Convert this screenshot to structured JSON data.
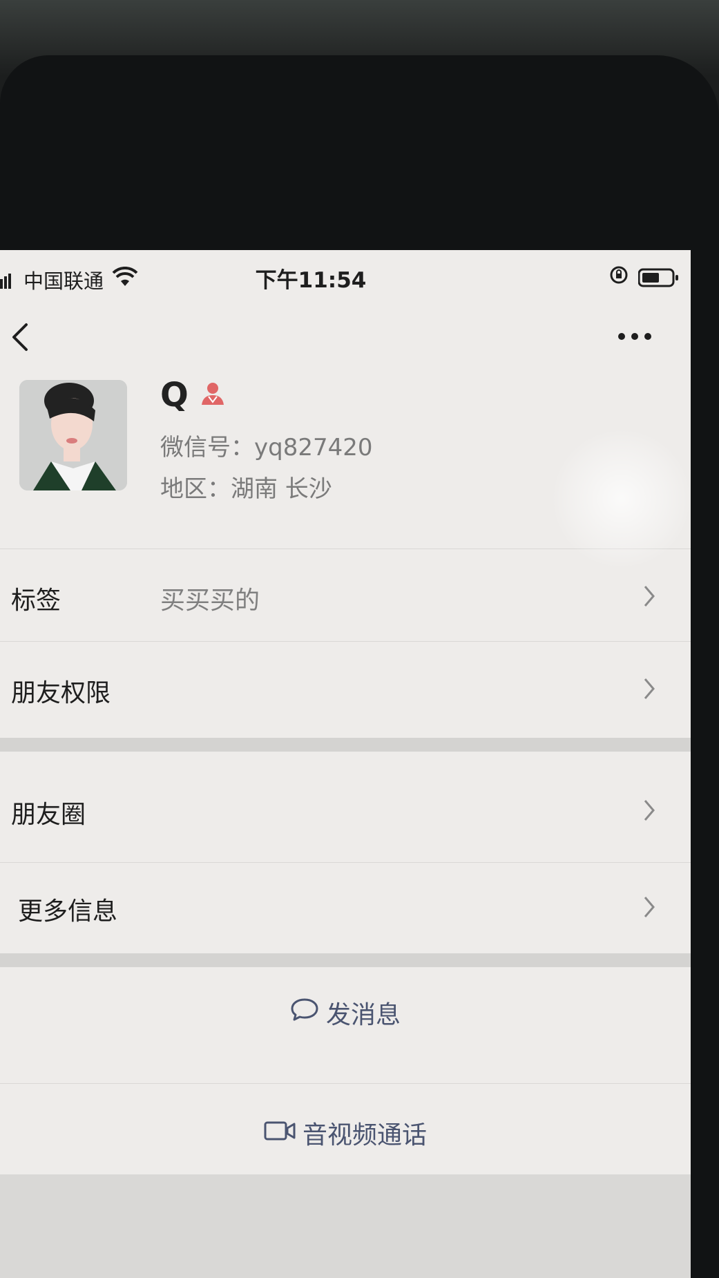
{
  "status_bar": {
    "carrier": "中国联通",
    "time": "下午11:54"
  },
  "profile": {
    "name": "Q",
    "wechat_id": "微信号：yq827420",
    "region": "地区：湖南 长沙"
  },
  "rows": {
    "tags": {
      "label": "标签",
      "value": "买买买的"
    },
    "friend_permissions": {
      "label": "朋友权限"
    },
    "moments": {
      "label": "朋友圈"
    },
    "more_info": {
      "label": "更多信息"
    }
  },
  "actions": {
    "send_message": "发消息",
    "av_call": "音视频通话"
  },
  "colors": {
    "screen_bg": "#eeecea",
    "action_text": "#4a5470",
    "gender_icon": "#e06666",
    "secondary_text": "#7a7a7a"
  },
  "icons": {
    "signal": "signal-bars-icon",
    "wifi": "wifi-icon",
    "rotation_lock": "rotation-lock-icon",
    "battery": "battery-icon",
    "back": "chevron-left-icon",
    "more": "ellipsis-icon",
    "gender": "female-icon",
    "chevron": "chevron-right-icon",
    "message": "chat-bubble-icon",
    "video": "video-camera-icon"
  }
}
